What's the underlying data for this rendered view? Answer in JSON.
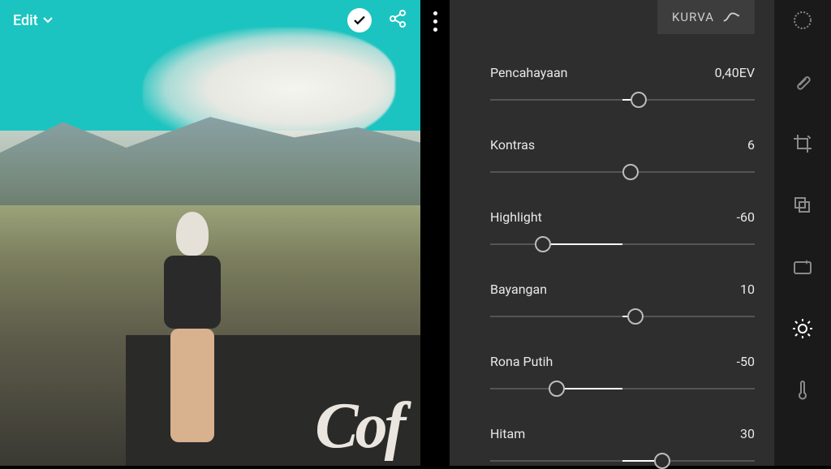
{
  "header": {
    "edit_label": "Edit"
  },
  "panel": {
    "tab_label": "KURVA"
  },
  "sliders": [
    {
      "label": "Pencahayaan",
      "value_text": "0,40EV",
      "pos": 56,
      "fill_from": 50,
      "fill_to": 56
    },
    {
      "label": "Kontras",
      "value_text": "6",
      "pos": 53,
      "fill_from": 50,
      "fill_to": 53
    },
    {
      "label": "Highlight",
      "value_text": "-60",
      "pos": 20,
      "fill_from": 20,
      "fill_to": 50
    },
    {
      "label": "Bayangan",
      "value_text": "10",
      "pos": 55,
      "fill_from": 50,
      "fill_to": 55
    },
    {
      "label": "Rona Putih",
      "value_text": "-50",
      "pos": 25,
      "fill_from": 25,
      "fill_to": 50
    },
    {
      "label": "Hitam",
      "value_text": "30",
      "pos": 65,
      "fill_from": 50,
      "fill_to": 65
    }
  ],
  "tools": [
    {
      "name": "radial-filter-icon",
      "active": false
    },
    {
      "name": "healing-icon",
      "active": false
    },
    {
      "name": "crop-icon",
      "active": false
    },
    {
      "name": "presets-icon",
      "active": false
    },
    {
      "name": "auto-icon",
      "active": false
    },
    {
      "name": "light-icon",
      "active": true
    },
    {
      "name": "temperature-icon",
      "active": false
    }
  ],
  "graffiti_text": "Cof"
}
